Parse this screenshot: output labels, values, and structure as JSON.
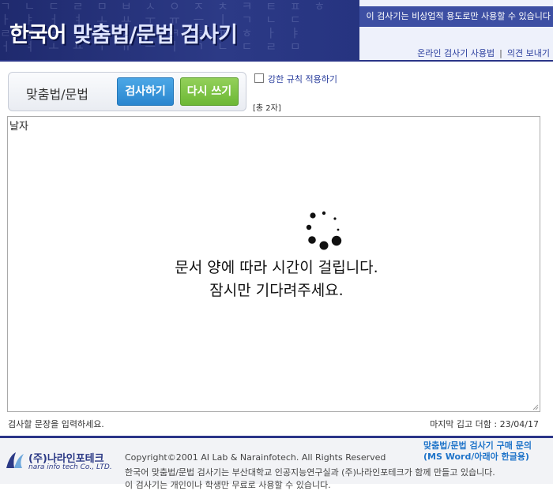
{
  "header": {
    "title_main": "한국어",
    "title_sub": "맞춤법/문법 검사기",
    "notice": "이 검사기는 비상업적 용도로만 사용할 수 있습니다",
    "link_usage": "온라인 검사기 사용법",
    "link_feedback": "의견 보내기"
  },
  "toolbar": {
    "label": "맞춤법/문법",
    "check_button": "검사하기",
    "reset_button": "다시 쓰기"
  },
  "options": {
    "strict_rule_label": "강한 규칙 적용하기",
    "strict_rule_checked": false,
    "char_count": "[총 2자]"
  },
  "editor": {
    "text": "날자"
  },
  "loading": {
    "line1": "문서 양에 따라 시간이 걸립니다.",
    "line2": "잠시만 기다려주세요."
  },
  "status": {
    "hint": "검사할 문장을 입력하세요.",
    "last_update": "마지막 깁고 더함 : 23/04/17"
  },
  "footer": {
    "company_name": "(주)나라인포테크",
    "company_eng": "nara info tech Co., LTD.",
    "copyright": "Copyright©2001 AI Lab & Narainfotech. All Rights Reserved",
    "desc1": "한국어 맞춤법/문법 검사기는 부산대학교 인공지능연구실과 (주)나라인포테크가 함께 만들고 있습니다.",
    "desc2": "이 검사기는 개인이나 학생만 무료로 사용할 수 있습니다.",
    "buy_line1": "맞춤법/문법 검사기 구매 문의",
    "buy_line2": "(MS Word/아래아 한글용)"
  },
  "colors": {
    "header_bg": "#2c3a86",
    "check_button": "#2a86cf",
    "reset_button": "#6db835",
    "link": "#2b3f9e"
  }
}
